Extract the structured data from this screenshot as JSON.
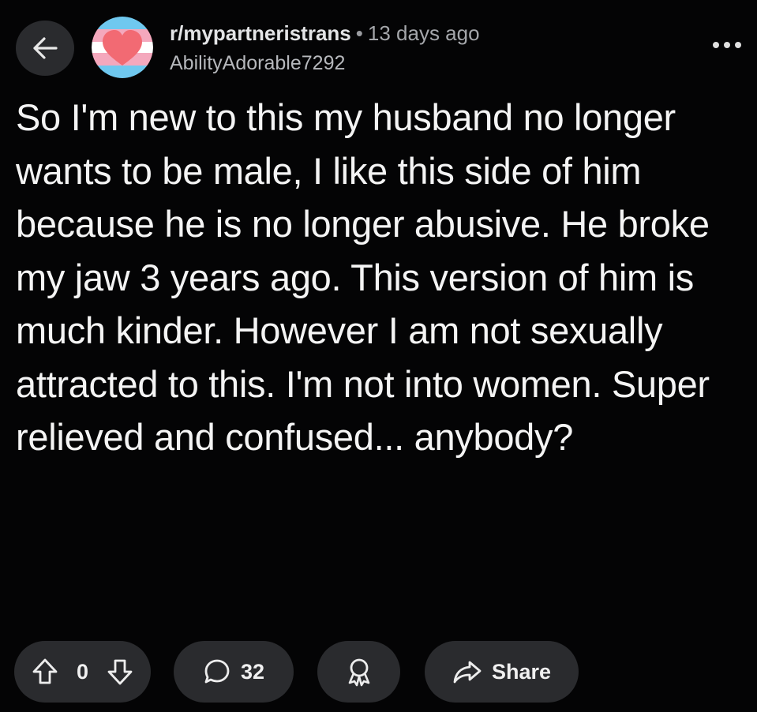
{
  "header": {
    "back_icon": "arrow-left-icon",
    "avatar_icon": "trans-flag-heart-avatar",
    "subreddit": "r/mypartneristrans",
    "separator": "•",
    "time_ago": "13 days ago",
    "author": "AbilityAdorable7292",
    "more_icon": "ellipsis-icon"
  },
  "post": {
    "body": "So I'm new to this my husband no longer wants to be male, I like this side of him because he is no longer abusive. He broke my jaw 3 years ago. This version of him is much kinder. However I am not sexually attracted to this. I'm not into women. Super relieved and confused... anybody?"
  },
  "actions": {
    "vote_count": "0",
    "comment_count": "32",
    "share_label": "Share",
    "upvote_icon": "arrow-up-outline-icon",
    "downvote_icon": "arrow-down-outline-icon",
    "comment_icon": "speech-bubble-icon",
    "award_icon": "award-icon",
    "share_icon": "share-arrow-icon"
  },
  "colors": {
    "background": "#040405",
    "pill": "#2a2b2e",
    "text": "#f4f4f4",
    "muted": "#a4a6aa",
    "flag_blue": "#6fc8ef",
    "flag_pink": "#f4a8bd",
    "heart": "#f26a73"
  }
}
